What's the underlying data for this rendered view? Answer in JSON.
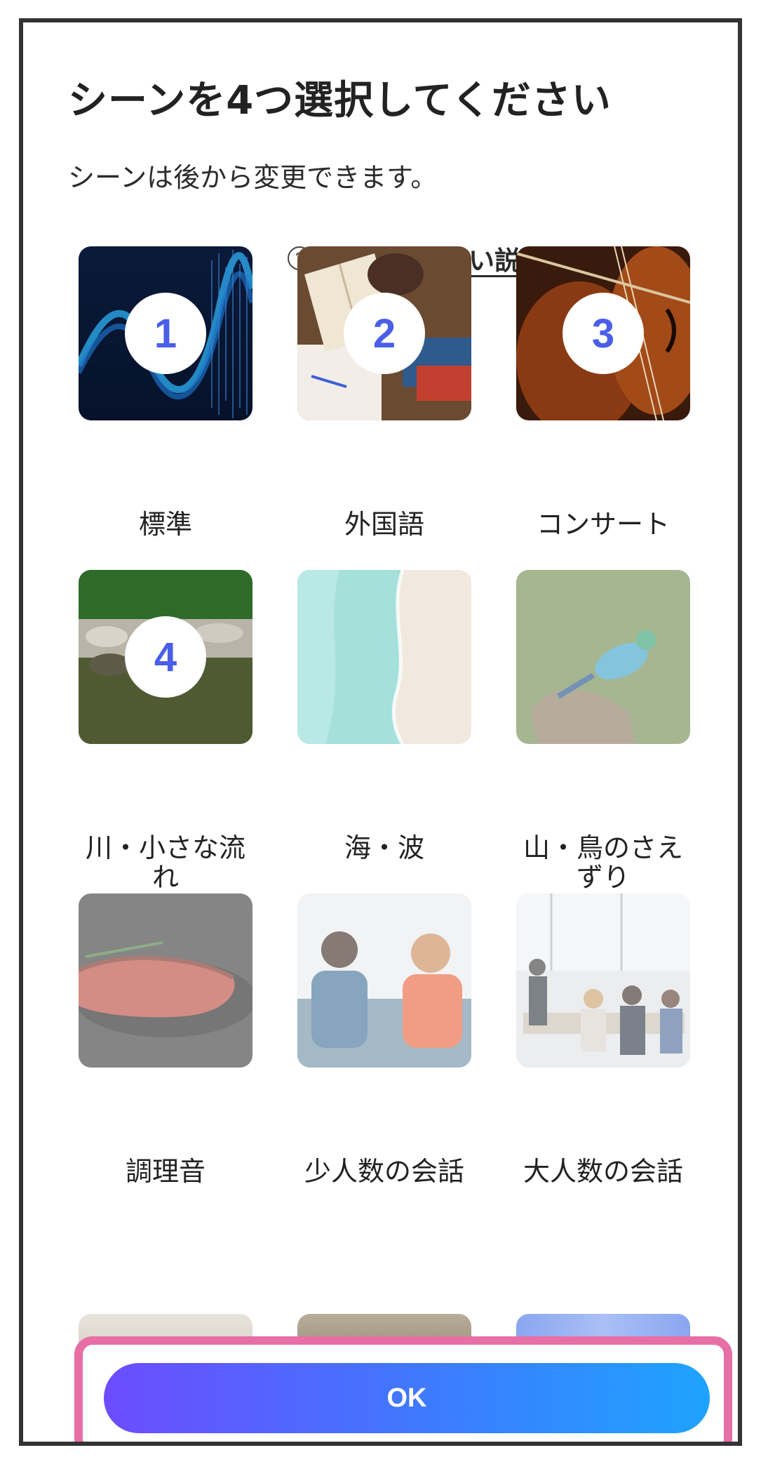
{
  "header": {
    "title": "シーンを4つ選択してください",
    "subtitle": "シーンは後から変更できます。",
    "help_icon": "?",
    "help_link": "シーンの詳しい説明を見る"
  },
  "scenes": [
    {
      "label": "標準",
      "badge": "1",
      "selected": true
    },
    {
      "label": "外国語",
      "badge": "2",
      "selected": true
    },
    {
      "label": "コンサート",
      "badge": "3",
      "selected": true
    },
    {
      "label": "川・小さな流れ",
      "badge": "4",
      "selected": true
    },
    {
      "label": "海・波",
      "selected": false
    },
    {
      "label": "山・鳥のさえずり",
      "selected": false
    },
    {
      "label": "調理音",
      "selected": false
    },
    {
      "label": "少人数の会話",
      "selected": false
    },
    {
      "label": "大人数の会話",
      "selected": false
    }
  ],
  "footer": {
    "ok_label": "OK"
  },
  "colors": {
    "badge_text": "#4a5ee8",
    "highlight_border": "#e86ea6",
    "button_gradient_start": "#6c4cff",
    "button_gradient_end": "#1ea3ff",
    "frame_border": "#333333"
  }
}
